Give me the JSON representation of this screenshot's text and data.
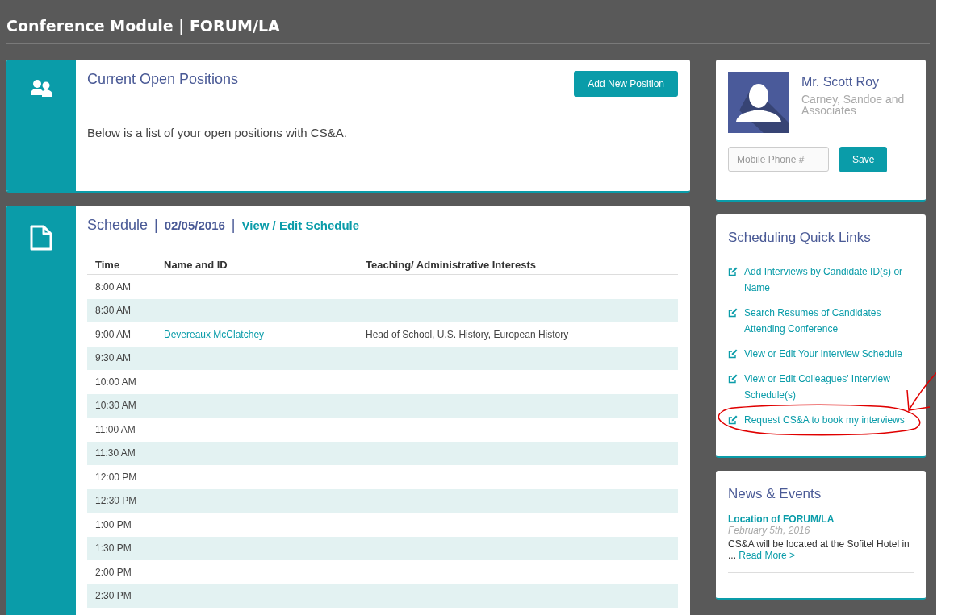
{
  "header": {
    "title": "Conference Module | FORUM/LA"
  },
  "positions": {
    "title": "Current Open Positions",
    "button": "Add New Position",
    "description": "Below is a list of your open positions with CS&A."
  },
  "schedule": {
    "heading": [
      {
        "kind": "title",
        "text": "Schedule"
      },
      {
        "kind": "separator",
        "text": "|"
      },
      {
        "kind": "date",
        "text": "02/05/2016"
      },
      {
        "kind": "separator",
        "text": "|"
      },
      {
        "kind": "link",
        "text": "View / Edit Schedule"
      }
    ],
    "columns": [
      "Time",
      "Name and ID",
      "Teaching/ Administrative Interests"
    ],
    "rows": [
      {
        "time": "8:00 AM"
      },
      {
        "time": "8:30 AM"
      },
      {
        "time": "9:00 AM",
        "name": "Devereaux McClatchey",
        "interests": "Head of School, U.S. History, European History"
      },
      {
        "time": "9:30 AM"
      },
      {
        "time": "10:00 AM"
      },
      {
        "time": "10:30 AM"
      },
      {
        "time": "11:00 AM"
      },
      {
        "time": "11:30 AM"
      },
      {
        "time": "12:00 PM"
      },
      {
        "time": "12:30 PM"
      },
      {
        "time": "1:00 PM"
      },
      {
        "time": "1:30 PM"
      },
      {
        "time": "2:00 PM"
      },
      {
        "time": "2:30 PM"
      }
    ]
  },
  "profile": {
    "name": "Mr. Scott Roy",
    "company": "Carney, Sandoe and Associates",
    "phone_placeholder": "Mobile Phone #",
    "button": "Save"
  },
  "quick_links": {
    "title": "Scheduling Quick Links",
    "links": [
      {
        "text": "Add Interviews by Candidate ID(s) or Name",
        "circled": false
      },
      {
        "text": "Search Resumes of Candidates Attending Conference",
        "circled": false
      },
      {
        "text": "View or Edit Your Interview Schedule",
        "circled": false
      },
      {
        "text": "View or Edit Colleagues' Interview Schedule(s)",
        "circled": false
      },
      {
        "text": "Request CS&A to book my interviews",
        "circled": true
      }
    ]
  },
  "news": {
    "title": "News & Events",
    "items": [
      {
        "title": "Location of FORUM/LA",
        "date": "February 5th, 2016",
        "summary": "CS&A will be located at the Sofitel Hotel in ...",
        "read_more": "Read More >"
      }
    ]
  }
}
